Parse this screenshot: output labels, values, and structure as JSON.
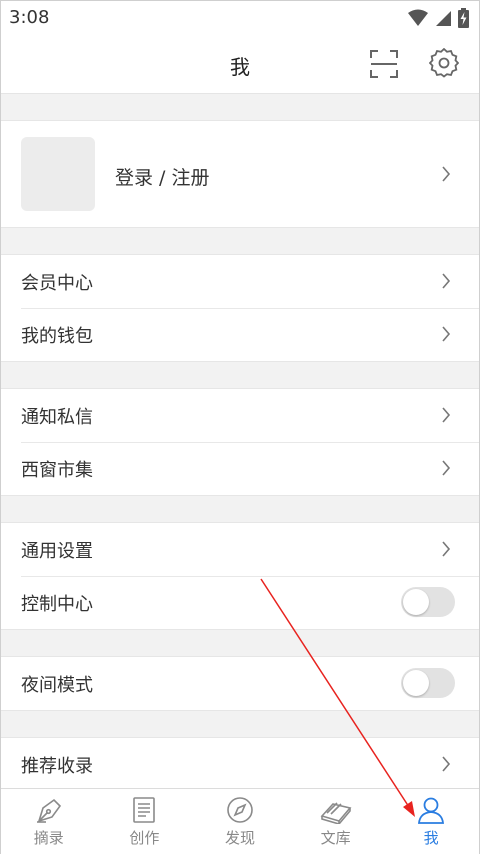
{
  "status": {
    "time": "3:08"
  },
  "header": {
    "title": "我"
  },
  "profile": {
    "login_label": "登录 / 注册"
  },
  "groups": [
    {
      "rows": [
        {
          "label": "会员中心",
          "control": "chevron"
        },
        {
          "label": "我的钱包",
          "control": "chevron"
        }
      ]
    },
    {
      "rows": [
        {
          "label": "通知私信",
          "control": "chevron"
        },
        {
          "label": "西窗市集",
          "control": "chevron"
        }
      ]
    },
    {
      "rows": [
        {
          "label": "通用设置",
          "control": "chevron"
        },
        {
          "label": "控制中心",
          "control": "toggle",
          "on": false
        }
      ]
    },
    {
      "rows": [
        {
          "label": "夜间模式",
          "control": "toggle",
          "on": false
        }
      ]
    },
    {
      "rows": [
        {
          "label": "推荐收录",
          "control": "chevron"
        }
      ]
    }
  ],
  "nav": {
    "items": [
      {
        "label": "摘录",
        "icon": "pen-nib-icon",
        "active": false
      },
      {
        "label": "创作",
        "icon": "document-icon",
        "active": false
      },
      {
        "label": "发现",
        "icon": "compass-icon",
        "active": false
      },
      {
        "label": "文库",
        "icon": "books-icon",
        "active": false
      },
      {
        "label": "我",
        "icon": "person-icon",
        "active": true
      }
    ]
  },
  "colors": {
    "accent": "#2a7de1",
    "annotation": "#e8231f",
    "toggle_off": "#e2e2e2"
  }
}
